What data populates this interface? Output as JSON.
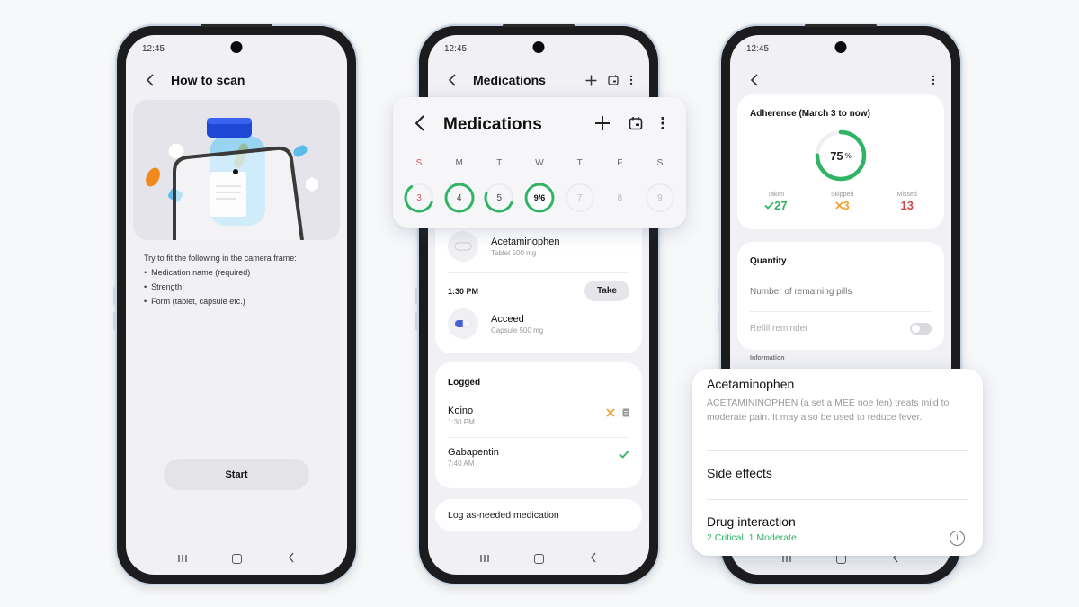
{
  "colors": {
    "accent_green": "#2fb463",
    "skip_orange": "#f0a030",
    "missed_red": "#d04545",
    "sunday_red": "#e05555",
    "bottle_cap_blue": "#1f47d6"
  },
  "phones": {
    "scan": {
      "status_time": "12:45",
      "title": "How to scan",
      "back_icon": "chevron-left-icon",
      "instructions_intro": "Try to fit the following in the camera frame:",
      "instructions_items": [
        "Medication name (required)",
        "Strength",
        "Form (tablet, capsule etc.)"
      ],
      "start_label": "Start",
      "nav": [
        "recents-icon",
        "home-icon",
        "back-icon"
      ]
    },
    "medications": {
      "status_time": "12:45",
      "title": "Medications",
      "actions": [
        "plus-icon",
        "calendar-icon",
        "more-vert-icon"
      ],
      "scheduled": [
        {
          "name": "Acetaminophen",
          "detail": "Tablet 500 mg",
          "pill_type": "tablet"
        }
      ],
      "slot": {
        "time": "1:30 PM",
        "take_label": "Take"
      },
      "slot_meds": [
        {
          "name": "Acceed",
          "detail": "Capsule 500 mg",
          "pill_type": "capsule"
        }
      ],
      "logged_title": "Logged",
      "logged": [
        {
          "name": "Koino",
          "time": "1:30 PM",
          "status": "skipped",
          "status_icon": "x-icon",
          "extra_icon": "note-icon"
        },
        {
          "name": "Gabapentin",
          "time": "7:40 AM",
          "status": "taken",
          "status_icon": "check-icon"
        }
      ],
      "log_as_needed_label": "Log as-needed medication"
    },
    "detail": {
      "status_time": "12:45",
      "adherence_title": "Adherence (March 3 to now)",
      "adherence_percent": 75,
      "adherence_percent_label": "75",
      "percent_sign": "%",
      "stats": [
        {
          "label": "Taken",
          "value": "27",
          "icon": "check-icon",
          "kind": "taken"
        },
        {
          "label": "Skipped",
          "value": "3",
          "icon": "x-icon",
          "kind": "skipped"
        },
        {
          "label": "Missed",
          "value": "13",
          "icon": "",
          "kind": "missed"
        }
      ],
      "quantity_title": "Quantity",
      "remaining_placeholder": "Number of remaining pills",
      "refill_label": "Refill reminder",
      "refill_enabled": false,
      "information_label": "Information"
    }
  },
  "floating_medications": {
    "title": "Medications",
    "actions": [
      "plus-icon",
      "calendar-icon",
      "more-vert-icon"
    ],
    "week": [
      {
        "letter": "S",
        "num": "3",
        "progress": 0.6,
        "sunday": true,
        "state": "partial"
      },
      {
        "letter": "M",
        "num": "4",
        "progress": 1.0,
        "state": "complete"
      },
      {
        "letter": "T",
        "num": "5",
        "progress": 0.5,
        "state": "partial"
      },
      {
        "letter": "W",
        "num": "9/6",
        "progress": 1.0,
        "state": "today"
      },
      {
        "letter": "T",
        "num": "7",
        "progress": 0,
        "state": "future"
      },
      {
        "letter": "F",
        "num": "8",
        "progress": 0,
        "state": "none"
      },
      {
        "letter": "S",
        "num": "9",
        "progress": 0,
        "state": "future"
      }
    ]
  },
  "floating_info": {
    "title": "Acetaminophen",
    "description": "ACETAMININOPHEN (a set a MEE noe fen) treats mild to moderate pain. It may also be used to reduce fever.",
    "side_effects_label": "Side effects",
    "drug_interaction_label": "Drug interaction",
    "drug_interaction_summary": "2 Critical, 1 Moderate",
    "info_icon": "info-icon"
  }
}
